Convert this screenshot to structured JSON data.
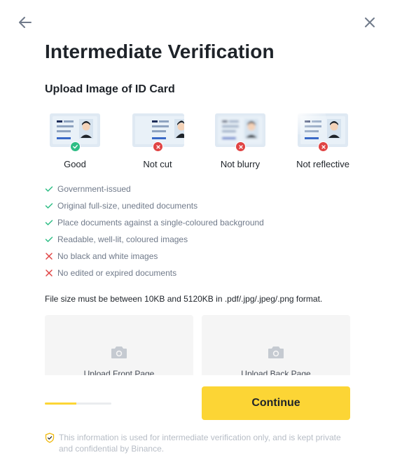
{
  "nav": {
    "back_icon": "arrow-left-icon",
    "close_icon": "close-icon"
  },
  "page": {
    "title": "Intermediate Verification",
    "subtitle": "Upload Image of ID Card"
  },
  "examples": [
    {
      "label": "Good",
      "status": "ok",
      "status_icon": "check-circle-icon"
    },
    {
      "label": "Not cut",
      "status": "bad",
      "status_icon": "cross-circle-icon"
    },
    {
      "label": "Not blurry",
      "status": "bad",
      "status_icon": "cross-circle-icon"
    },
    {
      "label": "Not reflective",
      "status": "bad",
      "status_icon": "cross-circle-icon"
    }
  ],
  "requirements": [
    {
      "text": "Government-issued",
      "allowed": true
    },
    {
      "text": "Original full-size, unedited documents",
      "allowed": true
    },
    {
      "text": "Place documents against a single-coloured background",
      "allowed": true
    },
    {
      "text": "Readable, well-lit, coloured images",
      "allowed": true
    },
    {
      "text": "No black and white images",
      "allowed": false
    },
    {
      "text": "No edited or expired documents",
      "allowed": false
    }
  ],
  "file_note": "File size must be between 10KB and 5120KB in .pdf/.jpg/.jpeg/.png format.",
  "uploads": {
    "front_label": "Upload Front Page",
    "back_label": "Upload Back Page",
    "icon": "camera-icon"
  },
  "progress": {
    "fraction": 0.47
  },
  "actions": {
    "continue_label": "Continue"
  },
  "footer": {
    "icon": "shield-check-icon",
    "note": "This information is used for intermediate verification only, and is kept private and confidential by Binance."
  },
  "colors": {
    "accent": "#fcd535",
    "success": "#2ebd85",
    "error": "#e04444",
    "text_primary": "#1e2329",
    "text_secondary": "#707a8a",
    "text_muted": "#b7bdc6"
  }
}
